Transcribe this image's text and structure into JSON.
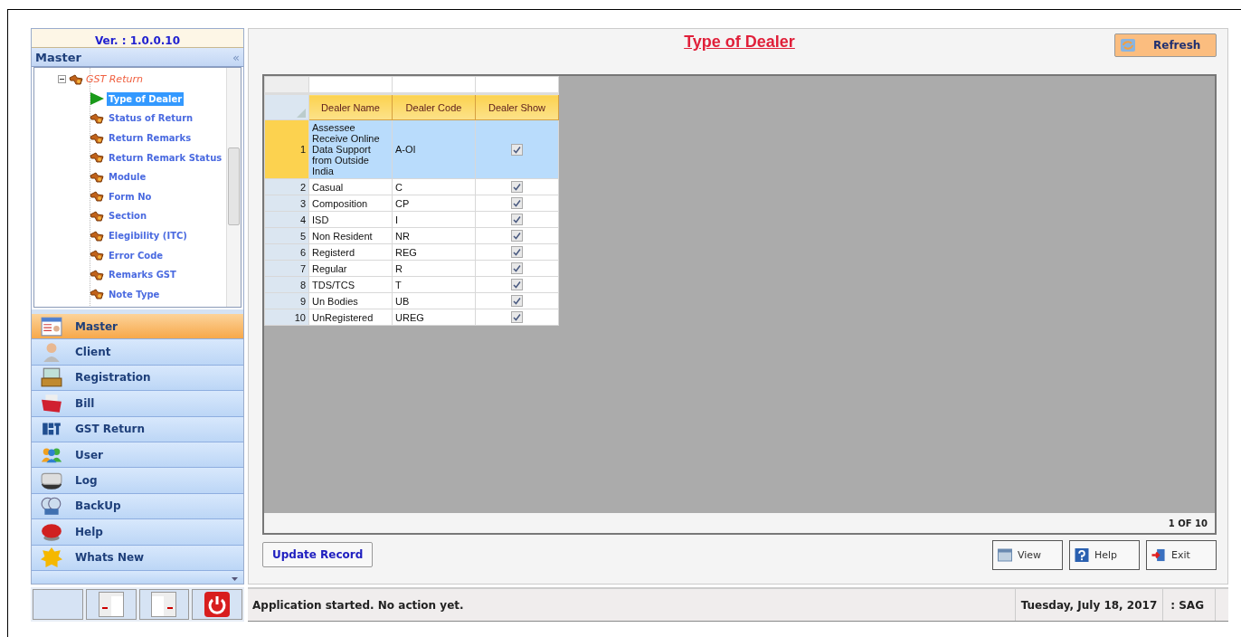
{
  "version": "Ver. : 1.0.0.10",
  "tree_panel": {
    "title": "Master",
    "collapse": "«"
  },
  "tree": [
    {
      "label": "GST Return",
      "expanded": true,
      "children": [
        {
          "label": "Type of Dealer",
          "selected": true
        },
        {
          "label": "Status of Return",
          "selected": false
        },
        {
          "label": "Return Remarks",
          "selected": false
        },
        {
          "label": "Return Remark Status",
          "selected": false
        },
        {
          "label": "Module",
          "selected": false
        },
        {
          "label": "Form No",
          "selected": false
        },
        {
          "label": "Section",
          "selected": false
        },
        {
          "label": "Elegibility (ITC)",
          "selected": false
        },
        {
          "label": "Error Code",
          "selected": false
        },
        {
          "label": "Remarks GST",
          "selected": false
        },
        {
          "label": "Note Type",
          "selected": false
        }
      ]
    }
  ],
  "nav": [
    {
      "label": "Master",
      "kind": "form",
      "selected": true
    },
    {
      "label": "Client",
      "kind": "person",
      "selected": false
    },
    {
      "label": "Registration",
      "kind": "register",
      "selected": false
    },
    {
      "label": "Bill",
      "kind": "folder",
      "selected": false
    },
    {
      "label": "GST Return",
      "kind": "gst",
      "selected": false
    },
    {
      "label": "User",
      "kind": "users",
      "selected": false
    },
    {
      "label": "Log",
      "kind": "log",
      "selected": false
    },
    {
      "label": "BackUp",
      "kind": "backup",
      "selected": false
    },
    {
      "label": "Help",
      "kind": "help",
      "selected": false
    },
    {
      "label": "Whats New",
      "kind": "new",
      "selected": false
    }
  ],
  "title": "Type of Dealer",
  "refresh": "Refresh",
  "table": {
    "columns": [
      "Dealer Name",
      "Dealer Code",
      "Dealer Show"
    ],
    "rows": [
      {
        "n": "1",
        "name": "Assessee Receive Online Data Support from Outside India",
        "code": "A-OI",
        "show": true,
        "selected": true
      },
      {
        "n": "2",
        "name": "Casual",
        "code": "C",
        "show": true,
        "selected": false
      },
      {
        "n": "3",
        "name": "Composition",
        "code": "CP",
        "show": true,
        "selected": false
      },
      {
        "n": "4",
        "name": "ISD",
        "code": "I",
        "show": true,
        "selected": false
      },
      {
        "n": "5",
        "name": "Non Resident",
        "code": "NR",
        "show": true,
        "selected": false
      },
      {
        "n": "6",
        "name": "Registerd",
        "code": "REG",
        "show": true,
        "selected": false
      },
      {
        "n": "7",
        "name": "Regular",
        "code": "R",
        "show": true,
        "selected": false
      },
      {
        "n": "8",
        "name": "TDS/TCS",
        "code": "T",
        "show": true,
        "selected": false
      },
      {
        "n": "9",
        "name": "Un Bodies",
        "code": "UB",
        "show": true,
        "selected": false
      },
      {
        "n": "10",
        "name": "UnRegistered",
        "code": "UREG",
        "show": true,
        "selected": false
      }
    ],
    "pager": "1 OF 10"
  },
  "update_button": "Update Record",
  "buttons": [
    {
      "label": "View",
      "kind": "view"
    },
    {
      "label": "Help",
      "kind": "help"
    },
    {
      "label": "Exit",
      "kind": "exit"
    }
  ],
  "status_bar": {
    "message": "Application started. No action yet.",
    "date": "Tuesday, July 18, 2017",
    "user": ": SAG"
  }
}
